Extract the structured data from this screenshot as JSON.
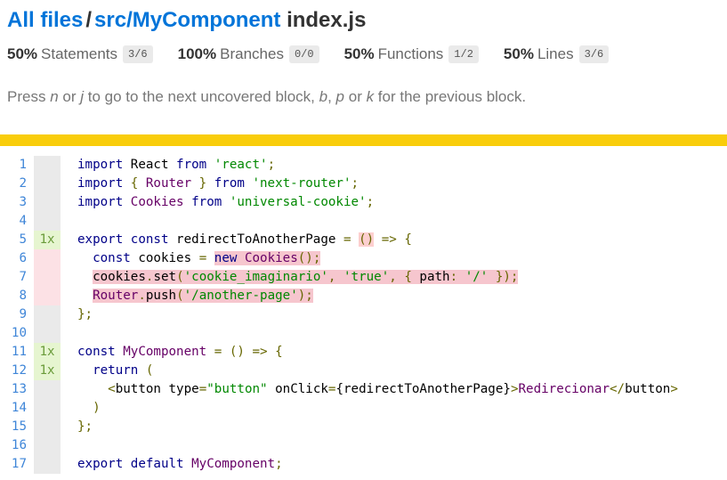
{
  "breadcrumb": {
    "all_files": "All files",
    "separator": "/",
    "dir": "src/MyComponent",
    "file": "index.js"
  },
  "stats": [
    {
      "pct": "50%",
      "label": "Statements",
      "fraction": "3/6"
    },
    {
      "pct": "100%",
      "label": "Branches",
      "fraction": "0/0"
    },
    {
      "pct": "50%",
      "label": "Functions",
      "fraction": "1/2"
    },
    {
      "pct": "50%",
      "label": "Lines",
      "fraction": "3/6"
    }
  ],
  "hint": {
    "t1": "Press ",
    "k1": "n",
    "t2": " or ",
    "k2": "j",
    "t3": " to go to the next uncovered block, ",
    "k3": "b",
    "t4": ", ",
    "k4": "p",
    "t5": " or ",
    "k5": "k",
    "t6": " for the previous block."
  },
  "colors": {
    "link": "#0074d9",
    "status_bar": "#f9cd0b",
    "uncovered": "#f6c6ce",
    "hit_count_bg": "#e6f5d0"
  },
  "lines": [
    {
      "n": "1",
      "count": "",
      "state": "neutral"
    },
    {
      "n": "2",
      "count": "",
      "state": "neutral"
    },
    {
      "n": "3",
      "count": "",
      "state": "neutral"
    },
    {
      "n": "4",
      "count": "",
      "state": "neutral"
    },
    {
      "n": "5",
      "count": "1x",
      "state": "hit"
    },
    {
      "n": "6",
      "count": "",
      "state": "miss"
    },
    {
      "n": "7",
      "count": "",
      "state": "miss"
    },
    {
      "n": "8",
      "count": "",
      "state": "miss"
    },
    {
      "n": "9",
      "count": "",
      "state": "neutral"
    },
    {
      "n": "10",
      "count": "",
      "state": "neutral"
    },
    {
      "n": "11",
      "count": "1x",
      "state": "hit"
    },
    {
      "n": "12",
      "count": "1x",
      "state": "hit"
    },
    {
      "n": "13",
      "count": "",
      "state": "neutral"
    },
    {
      "n": "14",
      "count": "",
      "state": "neutral"
    },
    {
      "n": "15",
      "count": "",
      "state": "neutral"
    },
    {
      "n": "16",
      "count": "",
      "state": "neutral"
    },
    {
      "n": "17",
      "count": "",
      "state": "neutral"
    }
  ],
  "code": {
    "l1": {
      "kw1": "import",
      "id": " React ",
      "kw2": "from",
      "sp": " ",
      "str": "'react'",
      "end": ";"
    },
    "l2": {
      "kw1": "import",
      "p1": " { ",
      "id": "Router",
      "p2": " } ",
      "kw2": "from",
      "sp": " ",
      "str": "'next-router'",
      "end": ";"
    },
    "l3": {
      "kw1": "import",
      "id": " Cookies ",
      "kw2": "from",
      "sp": " ",
      "str": "'universal-cookie'",
      "end": ";"
    },
    "l5": {
      "kw1": "export",
      "sp1": " ",
      "kw2": "const",
      "id": " redirectToAnotherPage ",
      "eq": "=",
      "sp2": " ",
      "params": "()",
      "sp3": " ",
      "arrow": "=>",
      "sp4": " ",
      "brace": "{"
    },
    "l6": {
      "indent": "  ",
      "kw": "const",
      "id": " cookies ",
      "eq": "=",
      "sp": " ",
      "new": "new",
      "sp2": " ",
      "cls": "Cookies",
      "call": "();"
    },
    "l7": {
      "indent": "  ",
      "obj": "cookies",
      "dot": ".",
      "fn": "set",
      "p1": "(",
      "s1": "'cookie_imaginario'",
      "c1": ", ",
      "s2": "'true'",
      "c2": ", { ",
      "key": "path",
      "col": ": ",
      "s3": "'/'",
      "p2": " });"
    },
    "l8": {
      "indent": "  ",
      "obj": "Router",
      "dot": ".",
      "fn": "push",
      "p1": "(",
      "s1": "'/another-page'",
      "p2": ");"
    },
    "l9": {
      "close": "};"
    },
    "l11": {
      "kw": "const",
      "sp": " ",
      "id": "MyComponent",
      "sp1": " ",
      "eq": "=",
      "sp2": " ",
      "params": "()",
      "sp3": " ",
      "arrow": "=>",
      "sp4": " ",
      "brace": "{"
    },
    "l12": {
      "indent": "  ",
      "kw": "return",
      "sp": " ",
      "paren": "("
    },
    "l13": {
      "indent": "    ",
      "lt": "<",
      "tag": "button",
      "sp": " ",
      "attr1": "type",
      "eq1": "=",
      "val1": "\"button\"",
      "sp2": " ",
      "attr2": "onClick",
      "eq2": "=",
      "val2": "{redirectToAnotherPage}",
      "gt": ">",
      "text": "Redirecionar",
      "close": "</",
      "tag2": "button",
      "gt2": ">"
    },
    "l14": {
      "indent": "  ",
      "paren": ")"
    },
    "l15": {
      "close": "};"
    },
    "l17": {
      "kw1": "export",
      "sp1": " ",
      "kw2": "default",
      "sp2": " ",
      "id": "MyComponent",
      "end": ";"
    }
  }
}
